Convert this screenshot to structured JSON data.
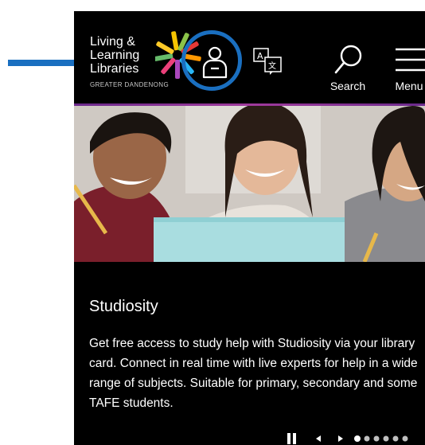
{
  "header": {
    "logo": {
      "line1": "Living &",
      "line2": "Learning",
      "line3": "Libraries",
      "subtitle": "GREATER DANDENONG"
    },
    "search_label": "Search",
    "menu_label": "Menu",
    "icons": {
      "account": "user-account-icon",
      "translate": "translate-icon",
      "search": "magnifier-icon",
      "menu": "hamburger-icon"
    }
  },
  "content": {
    "title": "Studiosity",
    "body": "Get free access to study help with Studiosity via your library card. Connect in real time with live experts for help in a wide range of subjects. Suitable for primary, secondary and some TAFE students."
  },
  "carousel": {
    "slide_count": 6,
    "active_index": 0
  },
  "colors": {
    "background": "#000000",
    "annotation_blue": "#1a6fc0",
    "accent_purple": "#8a3496"
  }
}
